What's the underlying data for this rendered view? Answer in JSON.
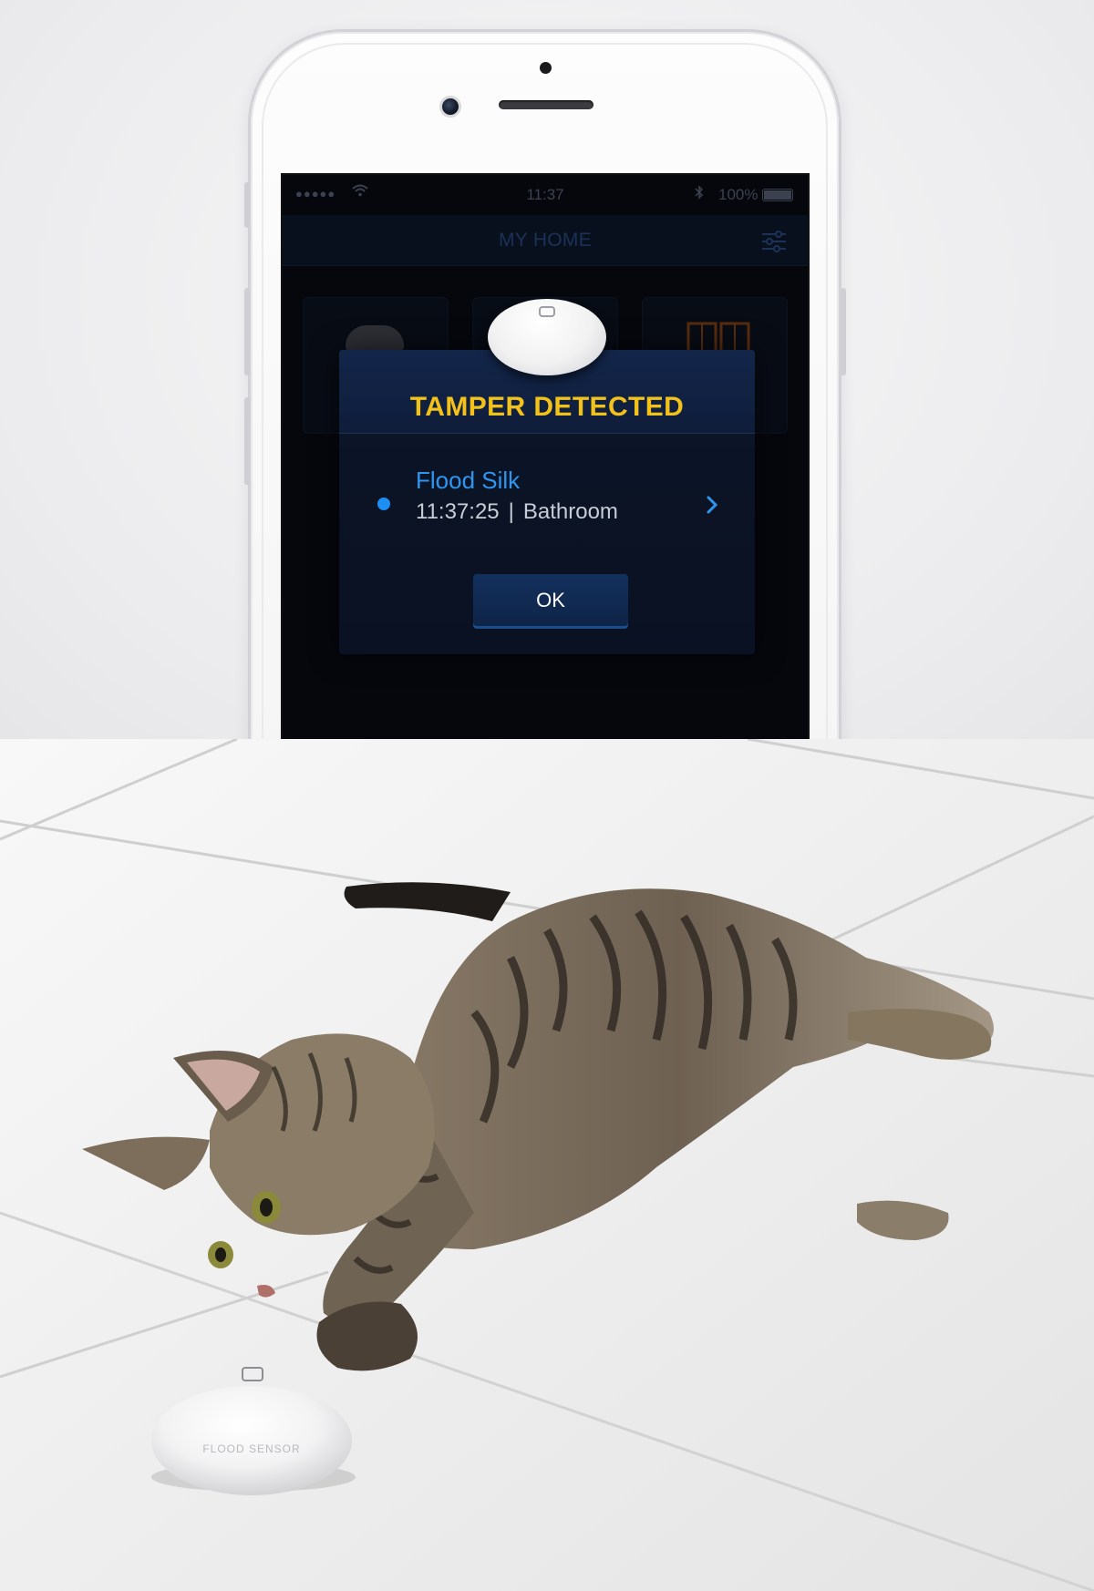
{
  "status_bar": {
    "signal": "●●●●●",
    "time": "11:37",
    "battery_text": "100%"
  },
  "nav": {
    "title": "MY HOME"
  },
  "alert": {
    "title": "TAMPER DETECTED",
    "device_name": "Flood Silk",
    "time": "11:37:25",
    "separator": "|",
    "room": "Bathroom",
    "ok_label": "OK"
  },
  "photo": {
    "sensor_label": "FLOOD SENSOR"
  },
  "colors": {
    "alert_title": "#f2c21a",
    "device_name": "#2d97f0",
    "dialog_bg": "#0b1426"
  }
}
